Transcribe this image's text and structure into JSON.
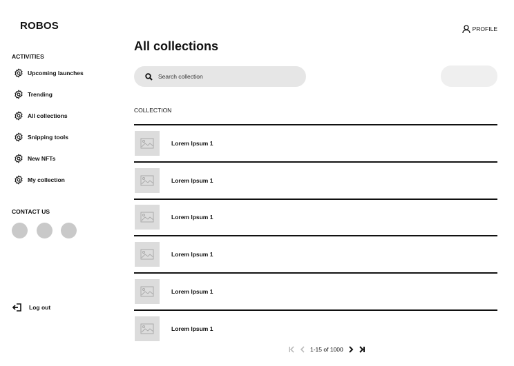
{
  "brand": "ROBOS",
  "sidebar": {
    "activities_label": "ACTIVITIES",
    "items": [
      {
        "label": "Upcoming launches"
      },
      {
        "label": "Trending"
      },
      {
        "label": "All collections"
      },
      {
        "label": "Snipping tools"
      },
      {
        "label": "New NFTs"
      },
      {
        "label": "My collection"
      }
    ],
    "contact_label": "CONTACT US",
    "logout_label": "Log out"
  },
  "header": {
    "profile_label": "PROFILE",
    "title": "All collections"
  },
  "search": {
    "placeholder": "Search collection"
  },
  "collection": {
    "heading": "COLLECTION",
    "rows": [
      {
        "name": "Lorem Ipsum 1"
      },
      {
        "name": "Lorem Ipsum 1"
      },
      {
        "name": "Lorem Ipsum 1"
      },
      {
        "name": "Lorem Ipsum 1"
      },
      {
        "name": "Lorem Ipsum 1"
      },
      {
        "name": "Lorem Ipsum 1"
      }
    ]
  },
  "pagination": {
    "range": "1-15 of 1000"
  }
}
